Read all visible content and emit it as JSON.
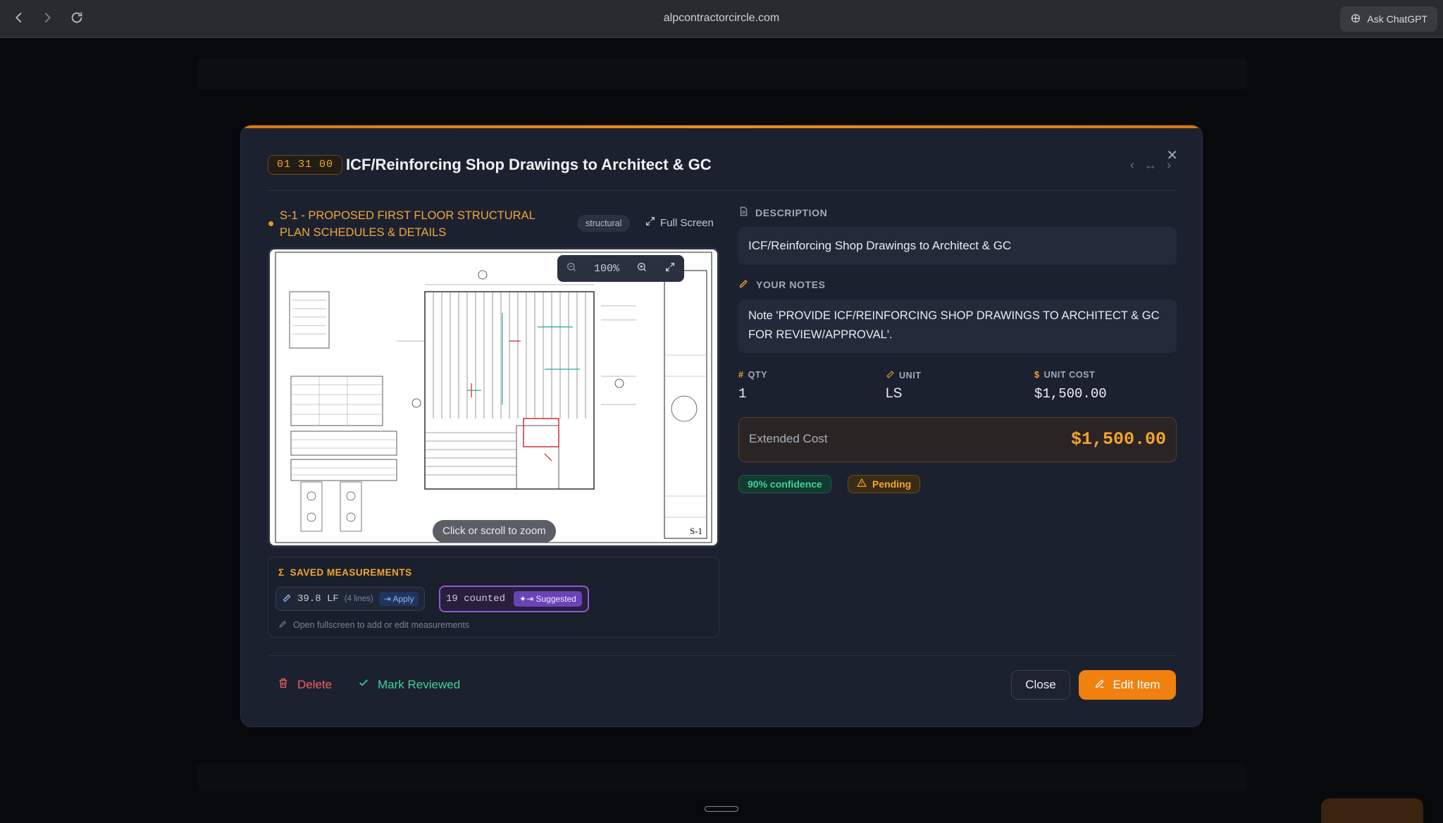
{
  "browser": {
    "url": "alpcontractorcircle.com",
    "ask_label": "Ask ChatGPT"
  },
  "item": {
    "code": "01 31 00",
    "title": "ICF/Reinforcing Shop Drawings to Architect & GC"
  },
  "sheet": {
    "title": "S-1 - PROPOSED FIRST FLOOR STRUCTURAL PLAN SCHEDULES & DETAILS",
    "tag": "structural",
    "fullscreen_label": "Full Screen",
    "zoom_level": "100%",
    "zoom_hint": "Click or scroll to zoom"
  },
  "measurements": {
    "title": "SAVED MEASUREMENTS",
    "length_value": "39.8 LF",
    "length_sub": "(4 lines)",
    "apply_label": "Apply",
    "count_value": "19 counted",
    "suggested_label": "Suggested",
    "hint": "Open fullscreen to add or edit measurements"
  },
  "description": {
    "label": "DESCRIPTION",
    "value": "ICF/Reinforcing Shop Drawings to Architect & GC"
  },
  "notes": {
    "label": "YOUR NOTES",
    "value": "Note 'PROVIDE ICF/REINFORCING SHOP DRAWINGS TO ARCHITECT & GC FOR REVIEW/APPROVAL'."
  },
  "fields": {
    "qty_label": "QTY",
    "qty_value": "1",
    "unit_label": "UNIT",
    "unit_value": "LS",
    "unit_cost_label": "UNIT COST",
    "unit_cost_value": "$1,500.00"
  },
  "extended": {
    "label": "Extended Cost",
    "value": "$1,500.00"
  },
  "status": {
    "confidence": "90% confidence",
    "state": "Pending"
  },
  "actions": {
    "delete": "Delete",
    "mark_reviewed": "Mark Reviewed",
    "close": "Close",
    "edit": "Edit Item"
  },
  "colors": {
    "accent": "#f0810f",
    "success": "#3fd39a",
    "danger": "#f06262",
    "modal_bg": "#1c2130"
  }
}
